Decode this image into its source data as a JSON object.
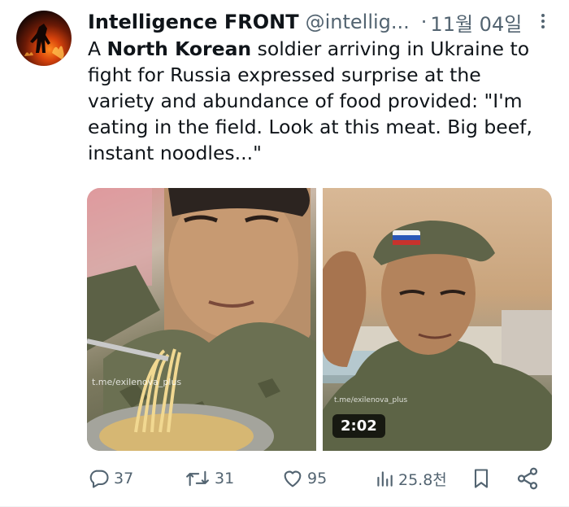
{
  "author": {
    "name": "Intelligence FRONT",
    "handle": "@intellig...",
    "separator": "·",
    "date": "11월 04일"
  },
  "tweet": {
    "text_part1": "A ",
    "text_bold": "North Korean",
    "text_part2": " soldier arriving in Ukraine to fight for Russia expressed surprise at the variety and abundance of food provided: \"I'm eating in the field. Look at this meat. Big beef, instant noodles...\""
  },
  "media": {
    "left_watermark": "t.me/exilenova_plus",
    "right_watermark": "t.me/exilenova_plus",
    "video_duration": "2:02"
  },
  "actions": {
    "replies": "37",
    "reposts": "31",
    "likes": "95",
    "views": "25.8천"
  },
  "colors": {
    "text": "#0f1419",
    "muted": "#536471"
  }
}
